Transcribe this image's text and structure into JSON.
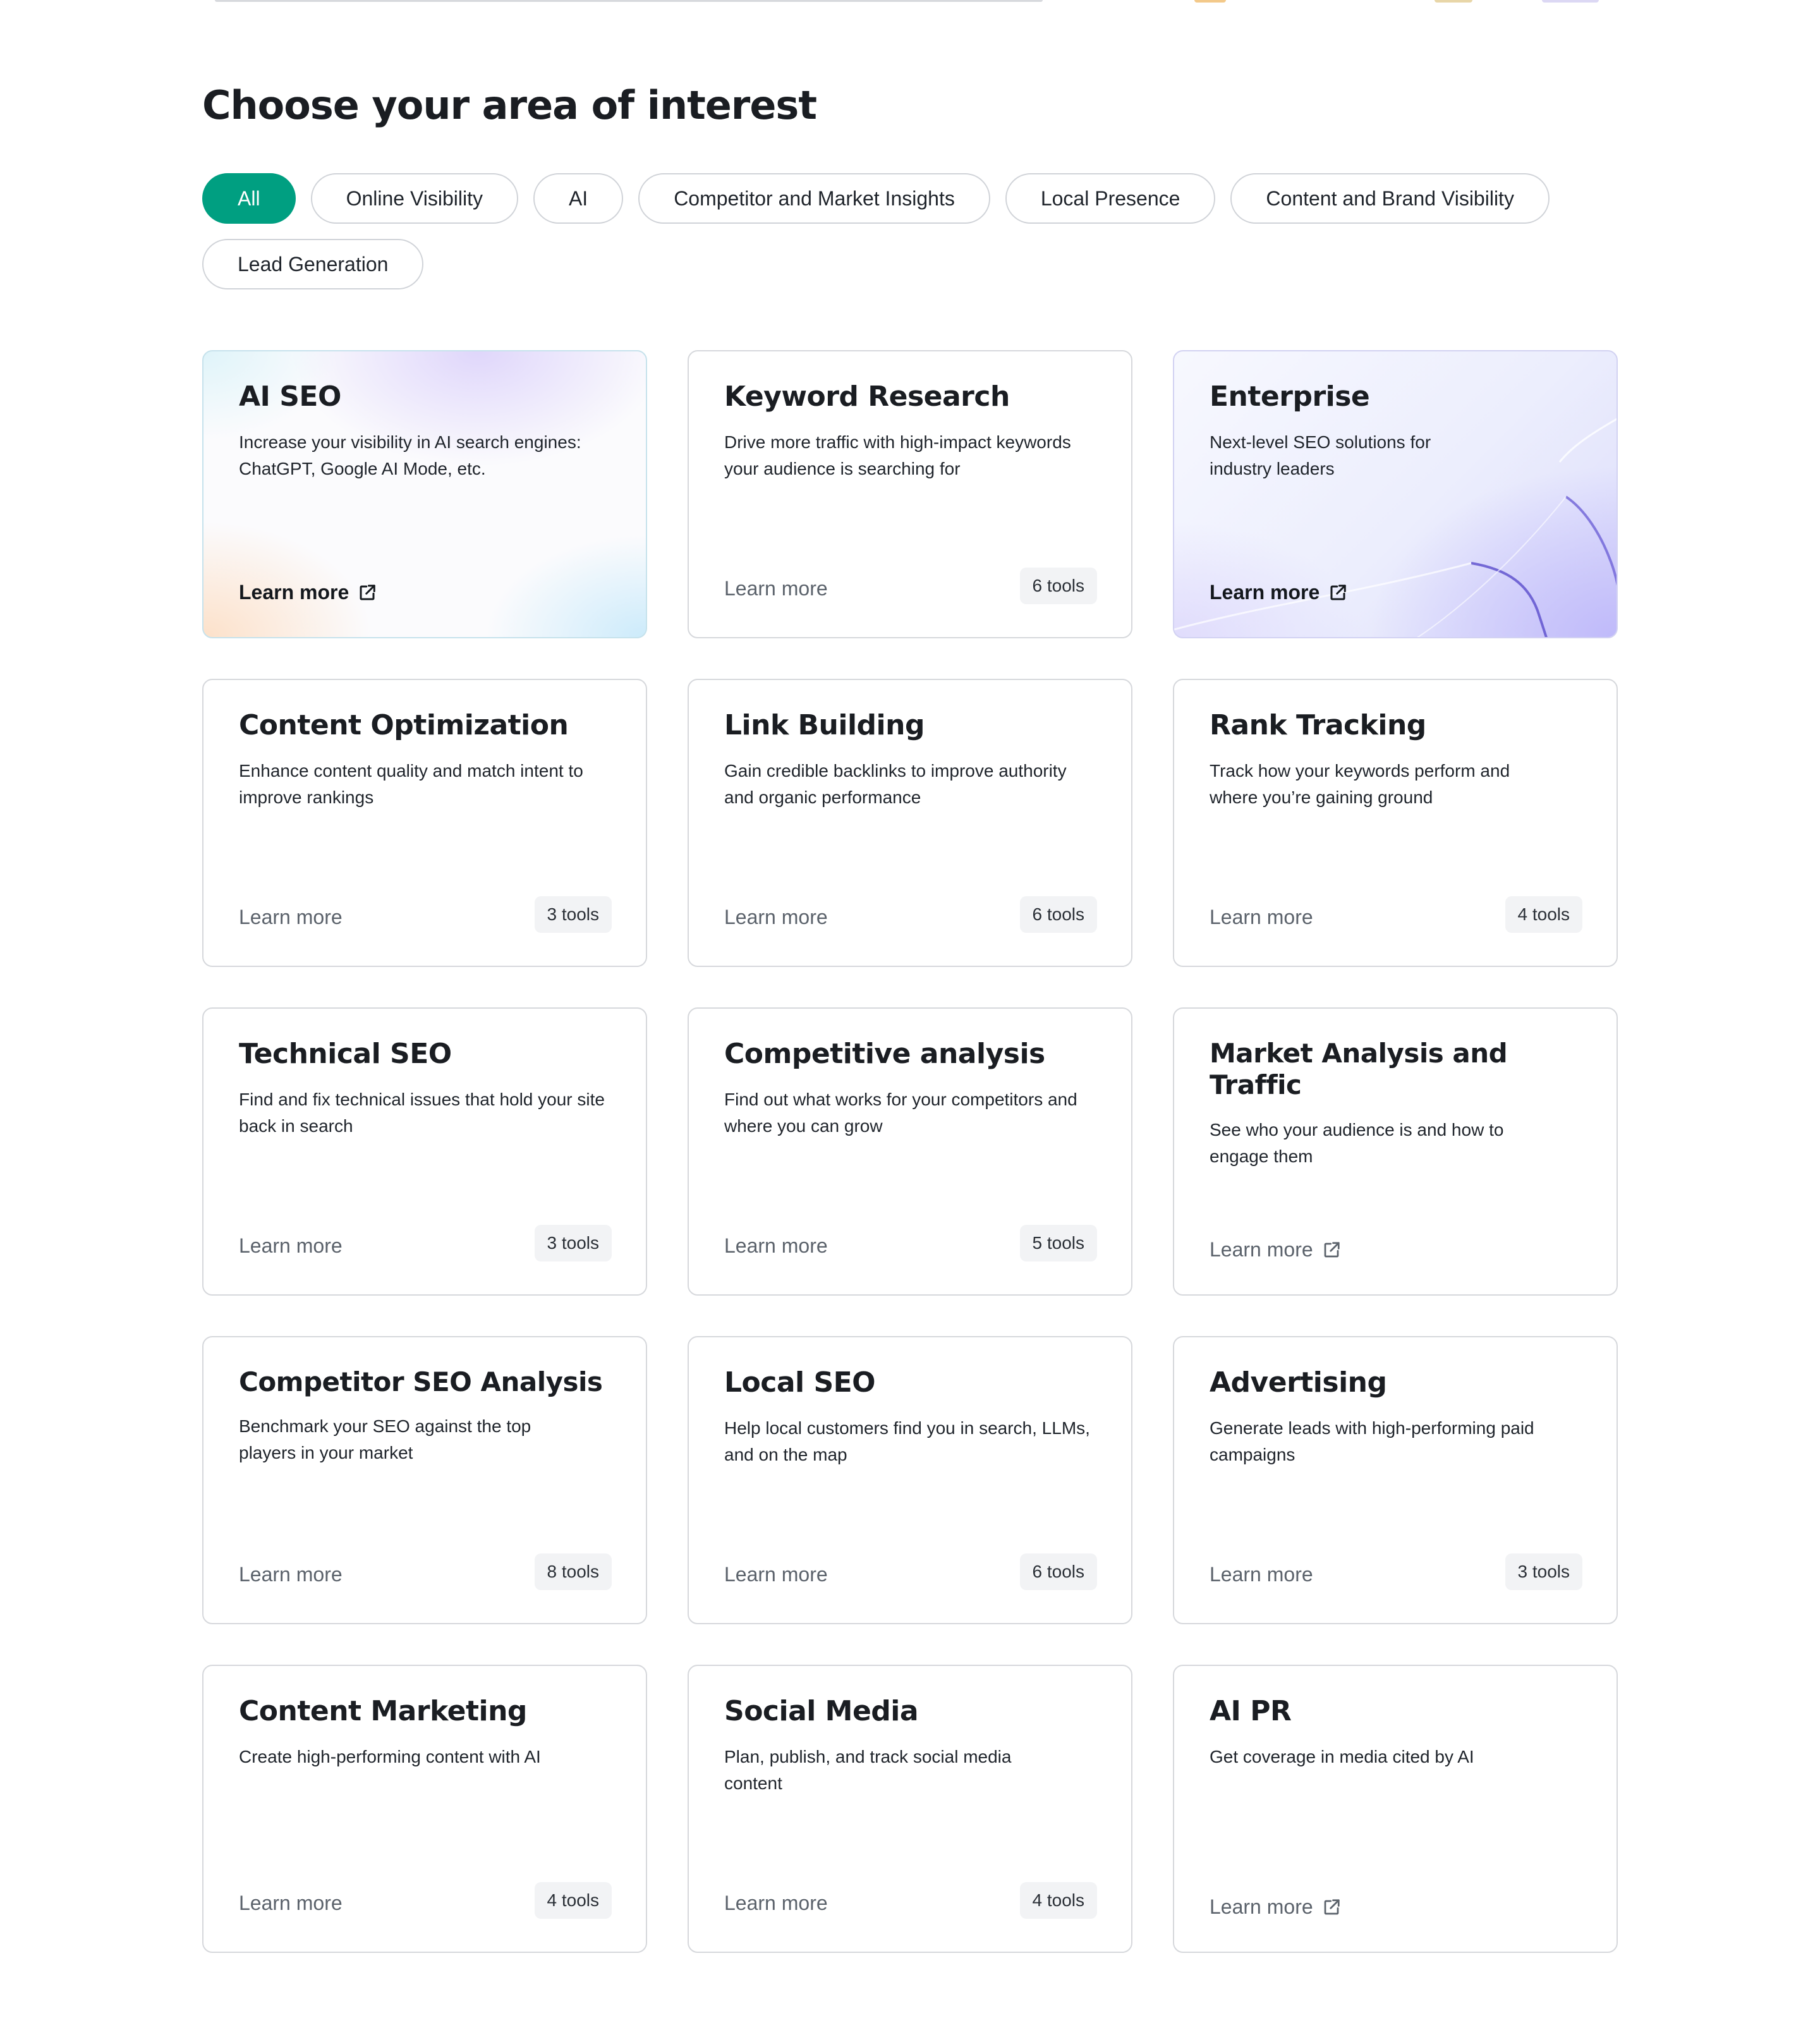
{
  "section_title": "Choose your area of interest",
  "filters": [
    {
      "label": "All",
      "active": true
    },
    {
      "label": "Online Visibility",
      "active": false
    },
    {
      "label": "AI",
      "active": false
    },
    {
      "label": "Competitor and Market Insights",
      "active": false
    },
    {
      "label": "Local Presence",
      "active": false
    },
    {
      "label": "Content and Brand Visibility",
      "active": false
    },
    {
      "label": "Lead Generation",
      "active": false
    }
  ],
  "colors": {
    "accent": "#009f81",
    "card_border": "#d6d8dc",
    "badge_bg": "#f2f3f5",
    "learn_more_muted": "#5b626b"
  },
  "cards": [
    {
      "title": "AI SEO",
      "description": "Increase your visibility in AI search engines: ChatGPT, Google AI Mode, etc.",
      "link": "Learn more",
      "external": true,
      "badge": ""
    },
    {
      "title": "Keyword Research",
      "description": "Drive more traffic with high-impact keywords your audience is searching for",
      "link": "Learn more",
      "external": false,
      "badge": "6 tools"
    },
    {
      "title": "Enterprise",
      "description": "Next-level SEO solutions for industry leaders",
      "link": "Learn more",
      "external": true,
      "badge": ""
    },
    {
      "title": "Content Optimization",
      "description": "Enhance content quality and match intent to improve rankings",
      "link": "Learn more",
      "external": false,
      "badge": "3 tools"
    },
    {
      "title": "Link Building",
      "description": "Gain credible backlinks to improve authority and organic performance",
      "link": "Learn more",
      "external": false,
      "badge": "6 tools"
    },
    {
      "title": "Rank Tracking",
      "description": "Track how your keywords perform and where you’re gaining ground",
      "link": "Learn more",
      "external": false,
      "badge": "4 tools"
    },
    {
      "title": "Technical SEO",
      "description": "Find and fix technical issues that hold your site back in search",
      "link": "Learn more",
      "external": false,
      "badge": "3 tools"
    },
    {
      "title": "Competitive analysis",
      "description": "Find out what works for your competitors and where you can grow",
      "link": "Learn more",
      "external": false,
      "badge": "5 tools"
    },
    {
      "title": "Market Analysis and Traffic",
      "description": "See who your audience is and how to engage them",
      "link": "Learn more",
      "external": true,
      "badge": ""
    },
    {
      "title": "Competitor SEO Analysis",
      "description": "Benchmark your SEO against the top players in your market",
      "link": "Learn more",
      "external": false,
      "badge": "8 tools"
    },
    {
      "title": "Local SEO",
      "description": "Help local customers find you in search, LLMs, and on the map",
      "link": "Learn more",
      "external": false,
      "badge": "6 tools"
    },
    {
      "title": "Advertising",
      "description": "Generate leads with high-performing paid campaigns",
      "link": "Learn more",
      "external": false,
      "badge": "3 tools"
    },
    {
      "title": "Content Marketing",
      "description": "Create high-performing content with AI",
      "link": "Learn more",
      "external": false,
      "badge": "4 tools"
    },
    {
      "title": "Social Media",
      "description": "Plan, publish, and track social media content",
      "link": "Learn more",
      "external": false,
      "badge": "4 tools"
    },
    {
      "title": "AI PR",
      "description": "Get coverage in media cited by AI",
      "link": "Learn more",
      "external": true,
      "badge": ""
    }
  ]
}
